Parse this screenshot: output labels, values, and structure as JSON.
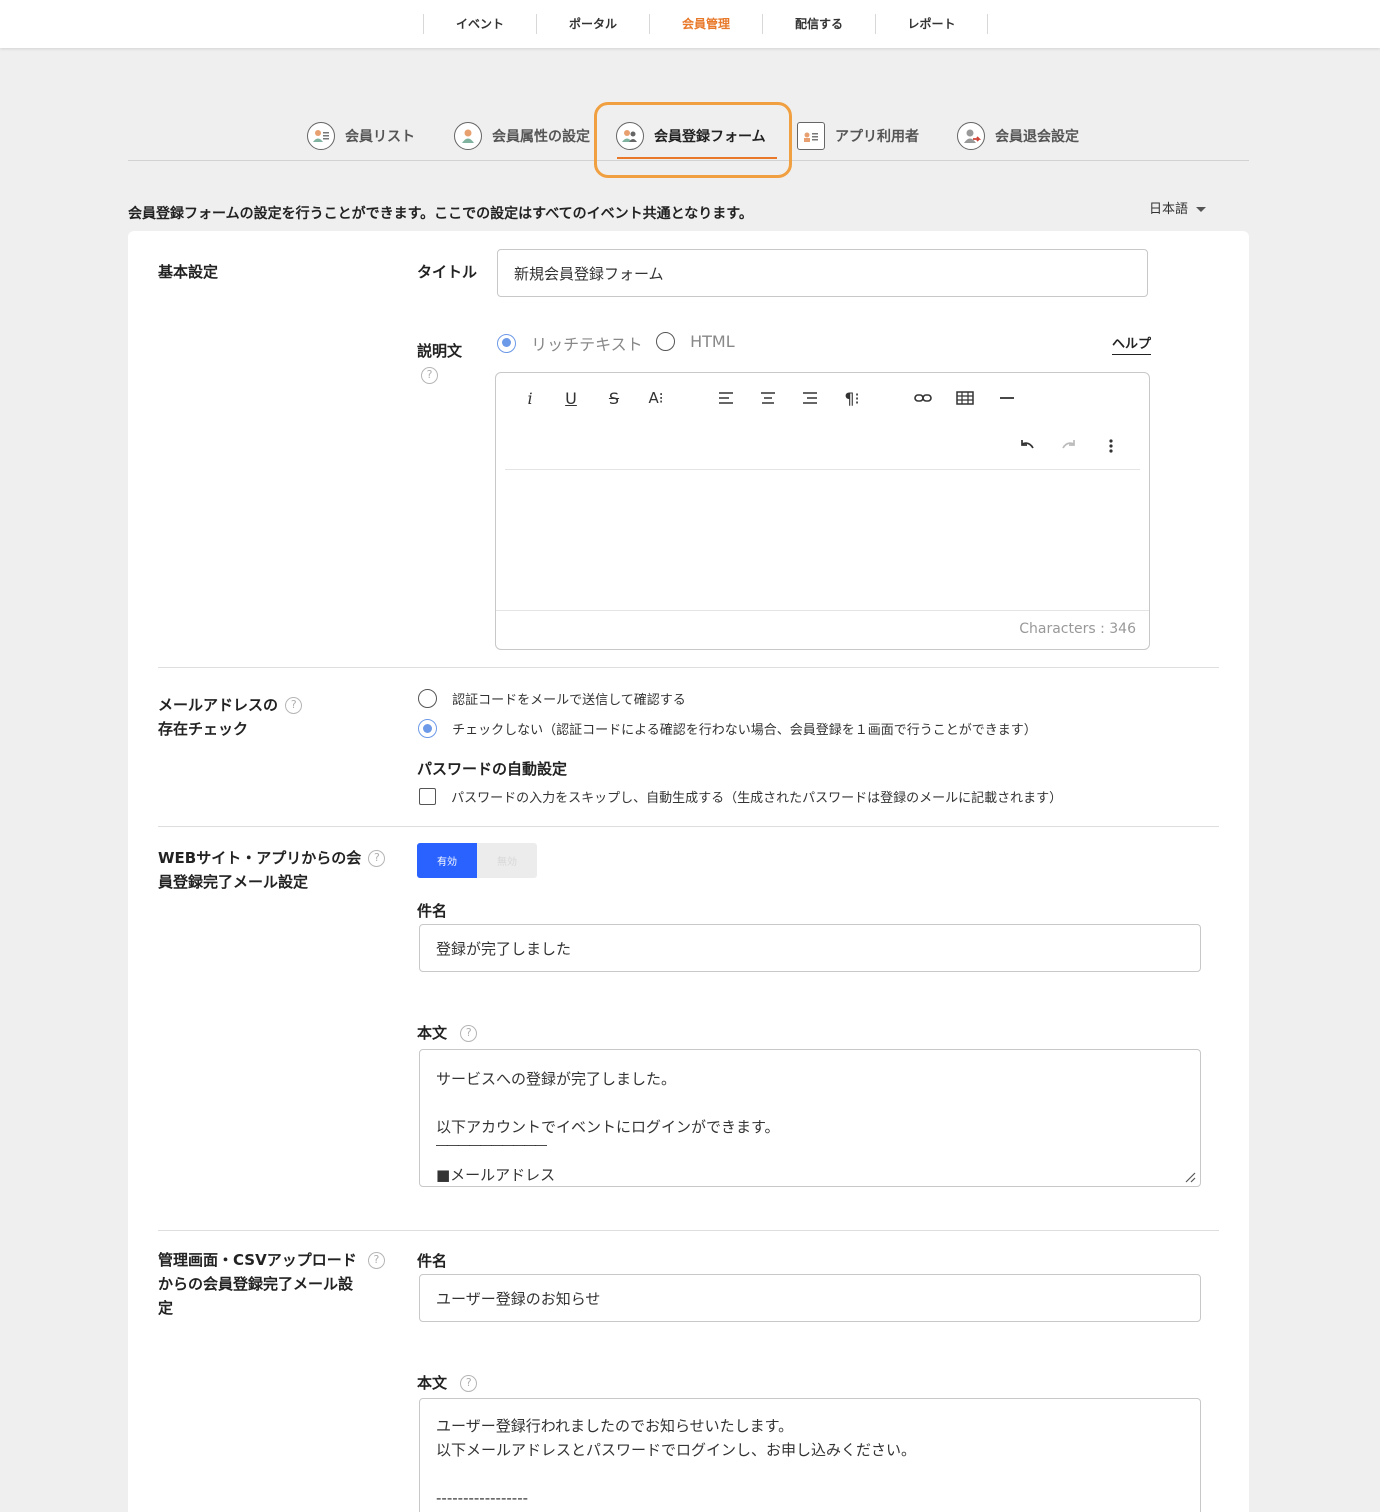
{
  "topnav": {
    "items": [
      "イベント",
      "ポータル",
      "会員管理",
      "配信する",
      "レポート"
    ],
    "active_index": 2
  },
  "subtabs": {
    "items": [
      "会員リスト",
      "会員属性の設定",
      "会員登録フォーム",
      "アプリ利用者",
      "会員退会設定"
    ],
    "active_index": 2
  },
  "page": {
    "description": "会員登録フォームの設定を行うことができます。ここでの設定はすべてのイベント共通となります。",
    "language": "日本語"
  },
  "basic": {
    "section_label": "基本設定",
    "title_label": "タイトル",
    "title_value": "新規会員登録フォーム",
    "desc_label": "説明文",
    "mode_rich": "リッチテキスト",
    "mode_html": "HTML",
    "selected_mode": "rich",
    "help_link": "ヘルプ",
    "char_count": "Characters : 346"
  },
  "email_check": {
    "section_label_1": "メールアドレスの",
    "section_label_2": "存在チェック",
    "option_verify": "認証コードをメールで送信して確認する",
    "option_skip": "チェックしない（認証コードによる確認を行わない場合、会員登録を１画面で行うことができます）",
    "selected": "skip",
    "password_label": "パスワードの自動設定",
    "password_option": "パスワードの入力をスキップし、自動生成する（生成されたパスワードは登録のメールに記載されます）",
    "password_checked": false
  },
  "web_mail": {
    "section_label_1": "WEBサイト・アプリからの会",
    "section_label_2": "員登録完了メール設定",
    "toggle_on": "有効",
    "toggle_off": "無効",
    "enabled": true,
    "subject_label": "件名",
    "subject_value": "登録が完了しました",
    "body_label": "本文",
    "body_lines": [
      "サービスへの登録が完了しました。",
      "",
      "以下アカウントでイベントにログインができます。",
      "――――――――――",
      "■メールアドレス"
    ]
  },
  "admin_mail": {
    "section_label_1": "管理画面・CSVアップロード",
    "section_label_2": "からの会員登録完了メール設",
    "section_label_3": "定",
    "subject_label": "件名",
    "subject_value": "ユーザー登録のお知らせ",
    "body_label": "本文",
    "body_lines": [
      "ユーザー登録行われましたのでお知らせいたします。",
      "以下メールアドレスとパスワードでログインし、お申し込みください。",
      "",
      "-----------------"
    ]
  },
  "colors": {
    "accent_orange": "#e8792b",
    "highlight_orange": "#f0a040",
    "toggle_blue": "#2962ff",
    "radio_blue": "#6d9ae8"
  }
}
